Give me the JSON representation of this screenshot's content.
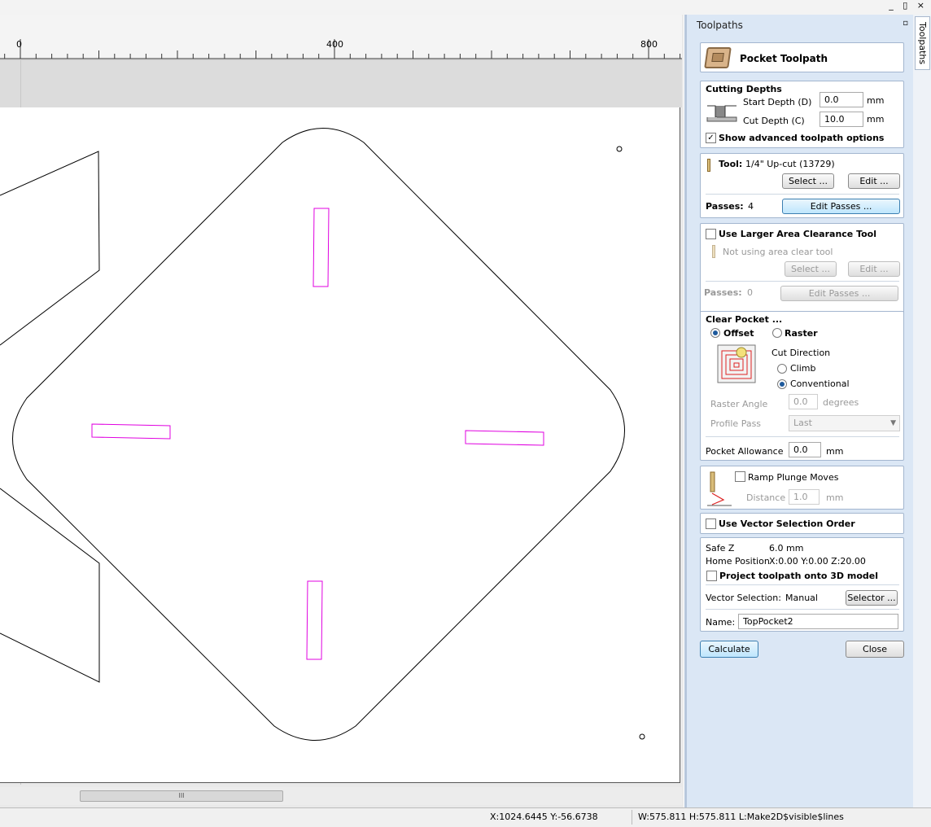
{
  "window": {
    "controls": "_ ▯ ×"
  },
  "ruler": {
    "ticks": [
      {
        "label": "0"
      },
      {
        "label": "400"
      },
      {
        "label": "800"
      }
    ]
  },
  "scroll": {
    "thumb_label": "III"
  },
  "status": {
    "coords": "X:1024.6445 Y:-56.6738",
    "selection": "W:575.811  H:575.811  L:Make2D$visible$lines"
  },
  "panel": {
    "title": "Toolpaths",
    "side_tab": "Toolpaths",
    "header": {
      "title": "Pocket Toolpath",
      "icon": "pocket-toolpath-icon"
    },
    "cutting_depths": {
      "title": "Cutting Depths",
      "start_label": "Start Depth (D)",
      "start_value": "0.0",
      "cut_label": "Cut Depth (C)",
      "cut_value": "10.0",
      "unit": "mm",
      "show_advanced_label": "Show advanced toolpath options",
      "show_advanced_checked": true
    },
    "tool": {
      "label": "Tool:",
      "name": "1/4\" Up-cut (13729)",
      "select_label": "Select ...",
      "edit_label": "Edit ...",
      "passes_label": "Passes:",
      "passes_value": "4",
      "edit_passes_label": "Edit Passes ..."
    },
    "area_clear": {
      "title": "Use Larger Area Clearance Tool",
      "status": "Not using area clear tool",
      "select_label": "Select ...",
      "edit_label": "Edit ...",
      "passes_label": "Passes:",
      "passes_value": "0",
      "edit_passes_label": "Edit Passes ..."
    },
    "clear_pocket": {
      "title": "Clear Pocket ...",
      "offset_label": "Offset",
      "raster_label": "Raster",
      "cut_direction_label": "Cut Direction",
      "climb_label": "Climb",
      "conventional_label": "Conventional",
      "raster_angle_label": "Raster Angle",
      "raster_angle_value": "0.0",
      "raster_angle_unit": "degrees",
      "profile_pass_label": "Profile Pass",
      "profile_pass_value": "Last",
      "allowance_label": "Pocket Allowance",
      "allowance_value": "0.0",
      "allowance_unit": "mm"
    },
    "ramp": {
      "label": "Ramp Plunge Moves",
      "distance_label": "Distance",
      "distance_value": "1.0",
      "distance_unit": "mm"
    },
    "vector_order": {
      "label": "Use Vector Selection Order"
    },
    "settings": {
      "safe_z_label": "Safe Z",
      "safe_z_value": "6.0 mm",
      "home_label": "Home Position",
      "home_value": "X:0.00 Y:0.00 Z:20.00",
      "project_label": "Project toolpath onto 3D model",
      "vector_sel_label": "Vector Selection:",
      "vector_sel_value": "Manual",
      "selector_label": "Selector ...",
      "name_label": "Name:",
      "name_value": "TopPocket2"
    },
    "buttons": {
      "calculate": "Calculate",
      "close": "Close"
    }
  },
  "colors": {
    "pocket_outline": "#000000",
    "tab_rectangles": "#e000e0",
    "panel_bg": "#dbe7f5",
    "accent": "#3c7fb1"
  }
}
